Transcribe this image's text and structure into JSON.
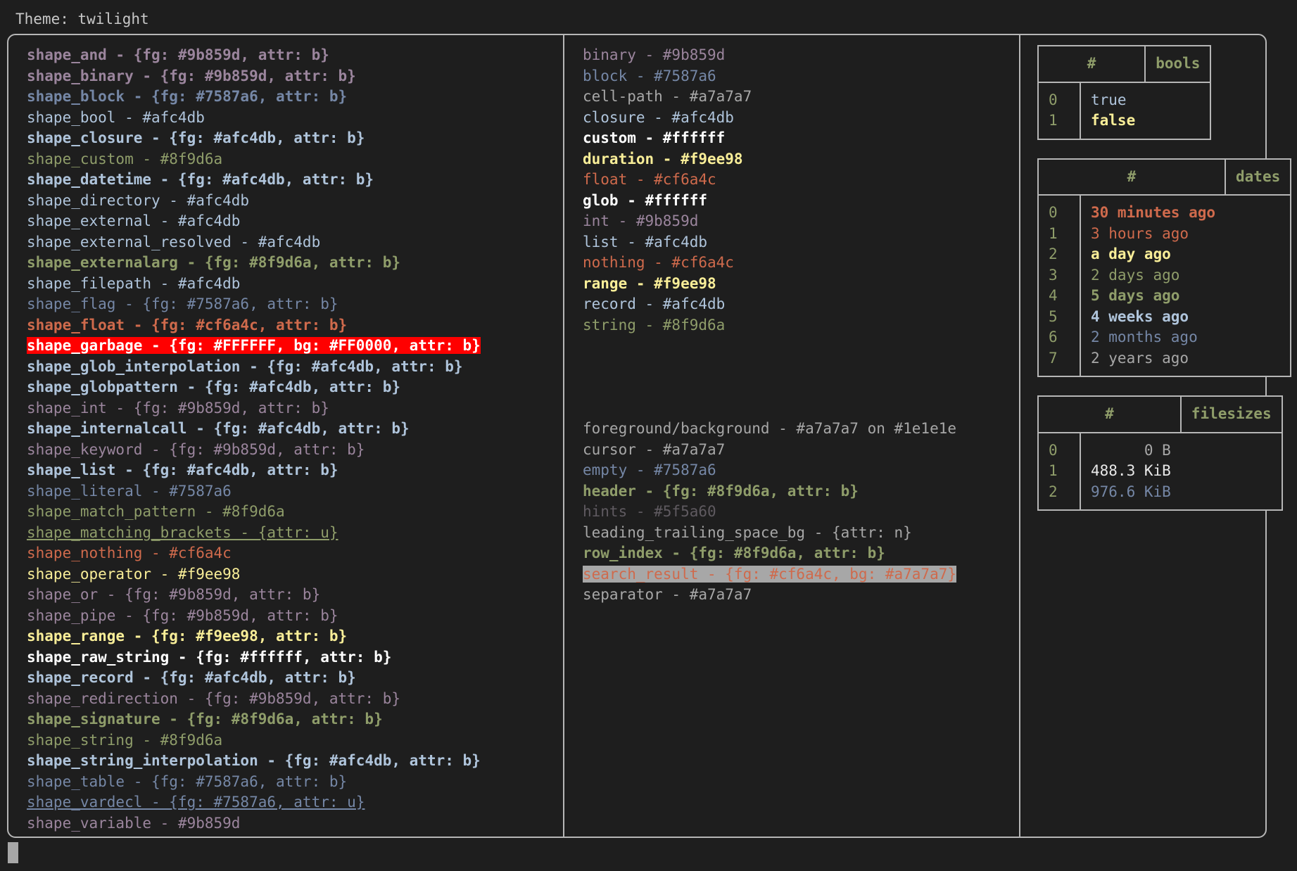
{
  "theme_line": "Theme: twilight",
  "colors": {
    "bg": "#1e1e1e",
    "outer_bg": "#1a1a1a",
    "fg": "#a7a7a7",
    "border": "#b6b6b6",
    "purple": "#9b859d",
    "blue": "#7587a6",
    "lightblue": "#afc4db",
    "olive": "#8f9d6a",
    "orange": "#cf6a4c",
    "yellow": "#f9ee98",
    "white": "#ffffff",
    "hints": "#5f5a60",
    "garbage_bg": "#ff0000",
    "garbage_fg": "#FFFFFF",
    "search_bg": "#a7a7a7",
    "cursor": "#a7a7a7"
  },
  "shapes": [
    {
      "text": "shape_and - {fg: #9b859d, attr: b}",
      "color": "#9b859d",
      "bold": true,
      "underline": false
    },
    {
      "text": "shape_binary - {fg: #9b859d, attr: b}",
      "color": "#9b859d",
      "bold": true,
      "underline": false
    },
    {
      "text": "shape_block - {fg: #7587a6, attr: b}",
      "color": "#7587a6",
      "bold": true,
      "underline": false
    },
    {
      "text": "shape_bool - #afc4db",
      "color": "#afc4db",
      "bold": false,
      "underline": false
    },
    {
      "text": "shape_closure - {fg: #afc4db, attr: b}",
      "color": "#afc4db",
      "bold": true,
      "underline": false
    },
    {
      "text": "shape_custom - #8f9d6a",
      "color": "#8f9d6a",
      "bold": false,
      "underline": false
    },
    {
      "text": "shape_datetime - {fg: #afc4db, attr: b}",
      "color": "#afc4db",
      "bold": true,
      "underline": false
    },
    {
      "text": "shape_directory - #afc4db",
      "color": "#afc4db",
      "bold": false,
      "underline": false
    },
    {
      "text": "shape_external - #afc4db",
      "color": "#afc4db",
      "bold": false,
      "underline": false
    },
    {
      "text": "shape_external_resolved - #afc4db",
      "color": "#afc4db",
      "bold": false,
      "underline": false
    },
    {
      "text": "shape_externalarg - {fg: #8f9d6a, attr: b}",
      "color": "#8f9d6a",
      "bold": true,
      "underline": false
    },
    {
      "text": "shape_filepath - #afc4db",
      "color": "#afc4db",
      "bold": false,
      "underline": false
    },
    {
      "text": "shape_flag - {fg: #7587a6, attr: b}",
      "color": "#7587a6",
      "bold": false,
      "underline": false
    },
    {
      "text": "shape_float - {fg: #cf6a4c, attr: b}",
      "color": "#cf6a4c",
      "bold": true,
      "underline": false
    },
    {
      "text": "shape_garbage - {fg: #FFFFFF, bg: #FF0000, attr: b}",
      "color": "#FFFFFF",
      "bold": true,
      "underline": false,
      "highlight": "garbage"
    },
    {
      "text": "shape_glob_interpolation - {fg: #afc4db, attr: b}",
      "color": "#afc4db",
      "bold": true,
      "underline": false
    },
    {
      "text": "shape_globpattern - {fg: #afc4db, attr: b}",
      "color": "#afc4db",
      "bold": true,
      "underline": false
    },
    {
      "text": "shape_int - {fg: #9b859d, attr: b}",
      "color": "#9b859d",
      "bold": false,
      "underline": false
    },
    {
      "text": "shape_internalcall - {fg: #afc4db, attr: b}",
      "color": "#afc4db",
      "bold": true,
      "underline": false
    },
    {
      "text": "shape_keyword - {fg: #9b859d, attr: b}",
      "color": "#9b859d",
      "bold": false,
      "underline": false
    },
    {
      "text": "shape_list - {fg: #afc4db, attr: b}",
      "color": "#afc4db",
      "bold": true,
      "underline": false
    },
    {
      "text": "shape_literal - #7587a6",
      "color": "#7587a6",
      "bold": false,
      "underline": false
    },
    {
      "text": "shape_match_pattern - #8f9d6a",
      "color": "#8f9d6a",
      "bold": false,
      "underline": false
    },
    {
      "text": "shape_matching_brackets - {attr: u}",
      "color": "#8f9d6a",
      "bold": false,
      "underline": true
    },
    {
      "text": "shape_nothing - #cf6a4c",
      "color": "#cf6a4c",
      "bold": false,
      "underline": false
    },
    {
      "text": "shape_operator - #f9ee98",
      "color": "#f9ee98",
      "bold": false,
      "underline": false
    },
    {
      "text": "shape_or - {fg: #9b859d, attr: b}",
      "color": "#9b859d",
      "bold": false,
      "underline": false
    },
    {
      "text": "shape_pipe - {fg: #9b859d, attr: b}",
      "color": "#9b859d",
      "bold": false,
      "underline": false
    },
    {
      "text": "shape_range - {fg: #f9ee98, attr: b}",
      "color": "#f9ee98",
      "bold": true,
      "underline": false
    },
    {
      "text": "shape_raw_string - {fg: #ffffff, attr: b}",
      "color": "#ffffff",
      "bold": true,
      "underline": false
    },
    {
      "text": "shape_record - {fg: #afc4db, attr: b}",
      "color": "#afc4db",
      "bold": true,
      "underline": false
    },
    {
      "text": "shape_redirection - {fg: #9b859d, attr: b}",
      "color": "#9b859d",
      "bold": false,
      "underline": false
    },
    {
      "text": "shape_signature - {fg: #8f9d6a, attr: b}",
      "color": "#8f9d6a",
      "bold": true,
      "underline": false
    },
    {
      "text": "shape_string - #8f9d6a",
      "color": "#8f9d6a",
      "bold": false,
      "underline": false
    },
    {
      "text": "shape_string_interpolation - {fg: #afc4db, attr: b}",
      "color": "#afc4db",
      "bold": true,
      "underline": false
    },
    {
      "text": "shape_table - {fg: #7587a6, attr: b}",
      "color": "#7587a6",
      "bold": false,
      "underline": false
    },
    {
      "text": "shape_vardecl - {fg: #7587a6, attr: u}",
      "color": "#7587a6",
      "bold": false,
      "underline": true
    },
    {
      "text": "shape_variable - #9b859d",
      "color": "#9b859d",
      "bold": false,
      "underline": false
    }
  ],
  "types": [
    {
      "text": "binary - #9b859d",
      "color": "#9b859d",
      "bold": false
    },
    {
      "text": "block - #7587a6",
      "color": "#7587a6",
      "bold": false
    },
    {
      "text": "cell-path - #a7a7a7",
      "color": "#a7a7a7",
      "bold": false
    },
    {
      "text": "closure - #afc4db",
      "color": "#afc4db",
      "bold": false
    },
    {
      "text": "custom - #ffffff",
      "color": "#ffffff",
      "bold": true
    },
    {
      "text": "duration - #f9ee98",
      "color": "#f9ee98",
      "bold": true
    },
    {
      "text": "float - #cf6a4c",
      "color": "#cf6a4c",
      "bold": false
    },
    {
      "text": "glob - #ffffff",
      "color": "#ffffff",
      "bold": true
    },
    {
      "text": "int - #9b859d",
      "color": "#9b859d",
      "bold": false
    },
    {
      "text": "list - #afc4db",
      "color": "#afc4db",
      "bold": false
    },
    {
      "text": "nothing - #cf6a4c",
      "color": "#cf6a4c",
      "bold": false
    },
    {
      "text": "range - #f9ee98",
      "color": "#f9ee98",
      "bold": true
    },
    {
      "text": "record - #afc4db",
      "color": "#afc4db",
      "bold": false
    },
    {
      "text": "string - #8f9d6a",
      "color": "#8f9d6a",
      "bold": false
    }
  ],
  "ui_elements": [
    {
      "text": "foreground/background - #a7a7a7 on #1e1e1e",
      "color": "#a7a7a7",
      "bold": false
    },
    {
      "text": "cursor - #a7a7a7",
      "color": "#a7a7a7",
      "bold": false
    },
    {
      "text": "empty - #7587a6",
      "color": "#7587a6",
      "bold": false
    },
    {
      "text": "header - {fg: #8f9d6a, attr: b}",
      "color": "#8f9d6a",
      "bold": true
    },
    {
      "text": "hints - #5f5a60",
      "color": "#5f5a60",
      "bold": false
    },
    {
      "text": "leading_trailing_space_bg - {attr: n}",
      "color": "#a7a7a7",
      "bold": false
    },
    {
      "text": "row_index - {fg: #8f9d6a, attr: b}",
      "color": "#8f9d6a",
      "bold": true
    },
    {
      "text": "search_result - {fg: #cf6a4c, bg: #a7a7a7}",
      "color": "#cf6a4c",
      "bold": false,
      "highlight": "search"
    },
    {
      "text": "separator - #a7a7a7",
      "color": "#a7a7a7",
      "bold": false
    }
  ],
  "tables": {
    "bools": {
      "index_header": "#",
      "value_header": "bools",
      "rows": [
        {
          "index": "0",
          "value": "true",
          "color": "#afc4db",
          "bold": false
        },
        {
          "index": "1",
          "value": "false",
          "color": "#f9ee98",
          "bold": true
        }
      ]
    },
    "dates": {
      "index_header": "#",
      "value_header": "dates",
      "rows": [
        {
          "index": "0",
          "value": "30 minutes ago",
          "color": "#cf6a4c",
          "bold": true
        },
        {
          "index": "1",
          "value": "3 hours ago",
          "color": "#cf6a4c",
          "bold": false
        },
        {
          "index": "2",
          "value": "a day ago",
          "color": "#f9ee98",
          "bold": true
        },
        {
          "index": "3",
          "value": "2 days ago",
          "color": "#8f9d6a",
          "bold": false
        },
        {
          "index": "4",
          "value": "5 days ago",
          "color": "#8f9d6a",
          "bold": true
        },
        {
          "index": "5",
          "value": "4 weeks ago",
          "color": "#afc4db",
          "bold": true
        },
        {
          "index": "6",
          "value": "2 months ago",
          "color": "#7587a6",
          "bold": false
        },
        {
          "index": "7",
          "value": "2 years ago",
          "color": "#a7a7a7",
          "bold": false
        }
      ]
    },
    "filesizes": {
      "index_header": "#",
      "value_header": "filesizes",
      "rows": [
        {
          "index": "0",
          "value": "0 B",
          "color": "#a7a7a7",
          "bold": false
        },
        {
          "index": "1",
          "value": "488.3 KiB",
          "color": "#e8e8e8",
          "bold": false
        },
        {
          "index": "2",
          "value": "976.6 KiB",
          "color": "#7587a6",
          "bold": false
        }
      ]
    }
  }
}
